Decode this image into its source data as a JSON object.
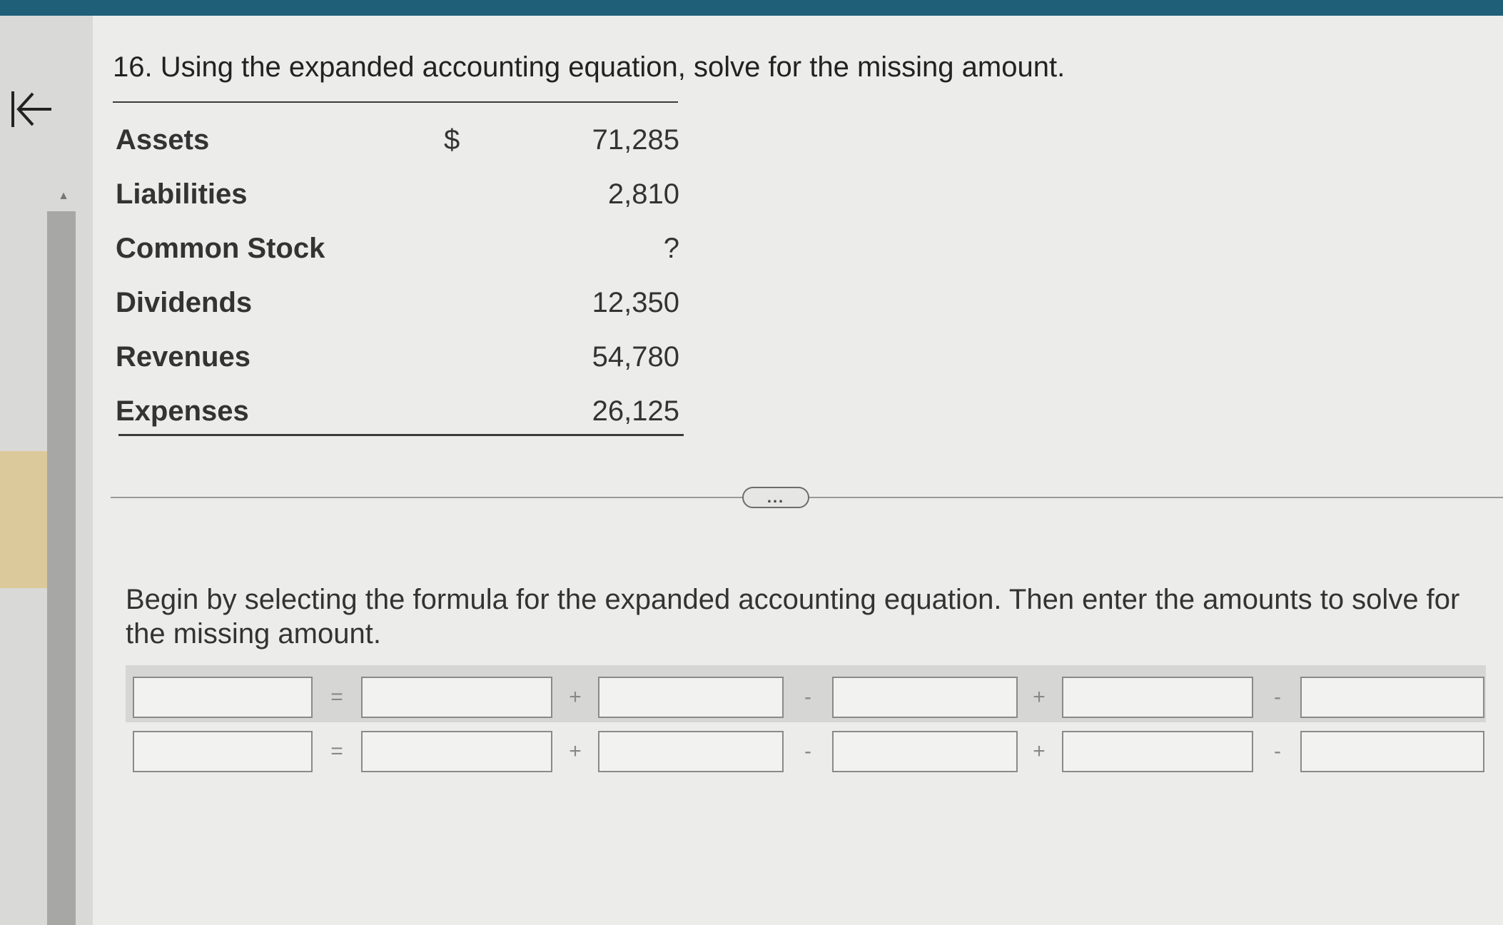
{
  "question": "16. Using the expanded accounting equation, solve for the missing amount.",
  "currency_symbol": "$",
  "rows": [
    {
      "label": "Assets",
      "value": "71,285"
    },
    {
      "label": "Liabilities",
      "value": "2,810"
    },
    {
      "label": "Common Stock",
      "value": "?"
    },
    {
      "label": "Dividends",
      "value": "12,350"
    },
    {
      "label": "Revenues",
      "value": "54,780"
    },
    {
      "label": "Expenses",
      "value": "26,125"
    }
  ],
  "expand_label": "...",
  "instructions": "Begin by selecting the formula for the expanded accounting equation. Then enter the amounts to solve for the missing amount.",
  "operators": [
    "=",
    "+",
    "-",
    "+",
    "-"
  ],
  "icons": {
    "back": "first-page-arrow-icon",
    "scroll_up": "scroll-up-arrow-icon"
  },
  "colors": {
    "top_bar": "#1f5f78",
    "nav_highlight": "#dcc99b"
  }
}
